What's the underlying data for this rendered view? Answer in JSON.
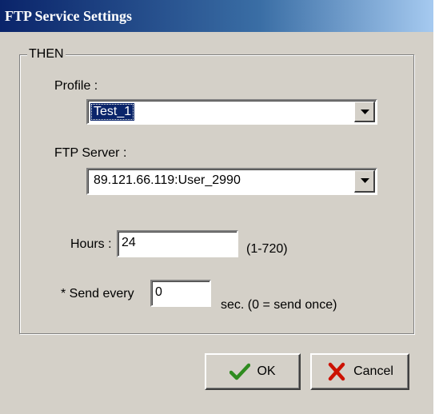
{
  "window": {
    "title": "FTP Service Settings"
  },
  "group": {
    "legend": "THEN"
  },
  "profile": {
    "label": "Profile :",
    "value": "Test_1"
  },
  "ftp_server": {
    "label": "FTP Server :",
    "value": "89.121.66.119:User_2990"
  },
  "hours": {
    "label": "Hours :",
    "value": "24",
    "range": "(1-720)"
  },
  "send_every": {
    "label": "* Send every",
    "value": "0",
    "hint": "sec. (0 = send once)"
  },
  "buttons": {
    "ok": "OK",
    "cancel": "Cancel"
  },
  "icons": {
    "ok": "checkmark-icon",
    "cancel": "x-icon",
    "dropdown": "dropdown-arrow-icon"
  },
  "colors": {
    "title_bar": "#0a246a",
    "selection": "#0a246a",
    "ok_icon": "#2e8b1f",
    "cancel_icon": "#cc1100",
    "face": "#d4d0c8"
  }
}
